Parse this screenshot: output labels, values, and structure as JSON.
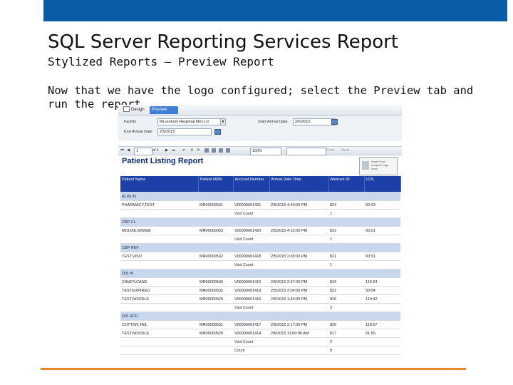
{
  "slide": {
    "title": "SQL Server Reporting Services Report",
    "subtitle": "Stylized Reports – Preview Report",
    "body": "Now that we have the logo configured; select the Preview tab and run the report."
  },
  "colors": {
    "top_bar": "#0b5ca8",
    "bottom_line": "#e8882a",
    "header_blue": "#1c3fa8",
    "group_band": "#c8d6ee"
  },
  "tabs": {
    "design": "Design",
    "preview": "Preview"
  },
  "params": {
    "facility_label": "Facility",
    "facility_value": "Mt.urahom Regional Mec Ltr",
    "start_label": "Start Arrival Date",
    "start_value": "2/5/2015",
    "end_label": "End Arrival Date",
    "end_value": "2/5/2015"
  },
  "toolbar": {
    "page": "1",
    "of_pages": "of 1",
    "zoom": "100%",
    "find": "Find",
    "next": "Next"
  },
  "report": {
    "title": "Patient Listing Report",
    "logo_text": "Insert Your Hospital Logo Here",
    "columns": [
      "Patient Name",
      "Patient MRN",
      "Account Number",
      "Arrival Date Time",
      "Abstract ID",
      "LOS"
    ],
    "rows": [
      {
        "type": "grp",
        "cells": [
          "ALIM IN",
          "",
          "",
          "",
          "",
          ""
        ]
      },
      {
        "type": "dat",
        "cells": [
          "PHARMACY,TEST",
          "MR00000531",
          "V00000001421",
          "2/5/2015 4:40:00 PM",
          "824",
          "00:03"
        ]
      },
      {
        "type": "cnt",
        "cells": [
          "",
          "",
          "Visit Count",
          "",
          "1",
          ""
        ]
      },
      {
        "type": "grp",
        "cells": [
          "CBP CL",
          "",
          "",
          "",
          "",
          ""
        ]
      },
      {
        "type": "dat",
        "cells": [
          "MOUSE,MINNIE",
          "MR00000063",
          "V00000001420",
          "2/5/2015 4:32:00 PM",
          "823",
          "00:01"
        ]
      },
      {
        "type": "cnt",
        "cells": [
          "",
          "",
          "Visit Count",
          "",
          "1",
          ""
        ]
      },
      {
        "type": "grp",
        "cells": [
          "CBP REF",
          "",
          "",
          "",
          "",
          ""
        ]
      },
      {
        "type": "dat",
        "cells": [
          "TEST,VISIT",
          "MR00000532",
          "V00000001418",
          "2/5/2015 2:05:00 PM",
          "821",
          "00:01"
        ]
      },
      {
        "type": "cnt",
        "cells": [
          "",
          "",
          "Visit Count",
          "",
          "1",
          ""
        ]
      },
      {
        "type": "grp",
        "cells": [
          "DIS IN",
          "",
          "",
          "",
          "",
          ""
        ]
      },
      {
        "type": "dat",
        "cells": [
          "CANDY,CANE",
          "MR00000530",
          "V00000001416",
          "2/5/2015 2:07:00 PM",
          "819",
          "119:24"
        ]
      },
      {
        "type": "dat",
        "cells": [
          "TEST,EXPIRED",
          "MR00000532",
          "V00000001419",
          "2/5/2015 3:04:00 PM",
          "822",
          "00:04"
        ]
      },
      {
        "type": "dat",
        "cells": [
          "TEST,NOODLE",
          "MR00000529",
          "V00000001415",
          "2/5/2015 1:40:00 PM",
          "810",
          "119:42"
        ]
      },
      {
        "type": "cnt",
        "cells": [
          "",
          "",
          "Visit Count",
          "",
          "3",
          ""
        ]
      },
      {
        "type": "grp",
        "cells": [
          "DIS RCR",
          "",
          "",
          "",
          "",
          ""
        ]
      },
      {
        "type": "dat",
        "cells": [
          "COTTON,TAIL",
          "MR00000531",
          "V00000001417",
          "2/5/2015 2:17:00 PM",
          "820",
          "118:57"
        ]
      },
      {
        "type": "dat",
        "cells": [
          "TEST,NOODLE",
          "MR00000529",
          "V00000001414",
          "2/6/2015 11:60:00 AM",
          "817",
          "01:50"
        ]
      },
      {
        "type": "cnt",
        "cells": [
          "",
          "",
          "Visit Count",
          "",
          "2",
          ""
        ]
      },
      {
        "type": "cnt",
        "cells": [
          "",
          "",
          "Count",
          "",
          "8",
          ""
        ]
      }
    ]
  }
}
